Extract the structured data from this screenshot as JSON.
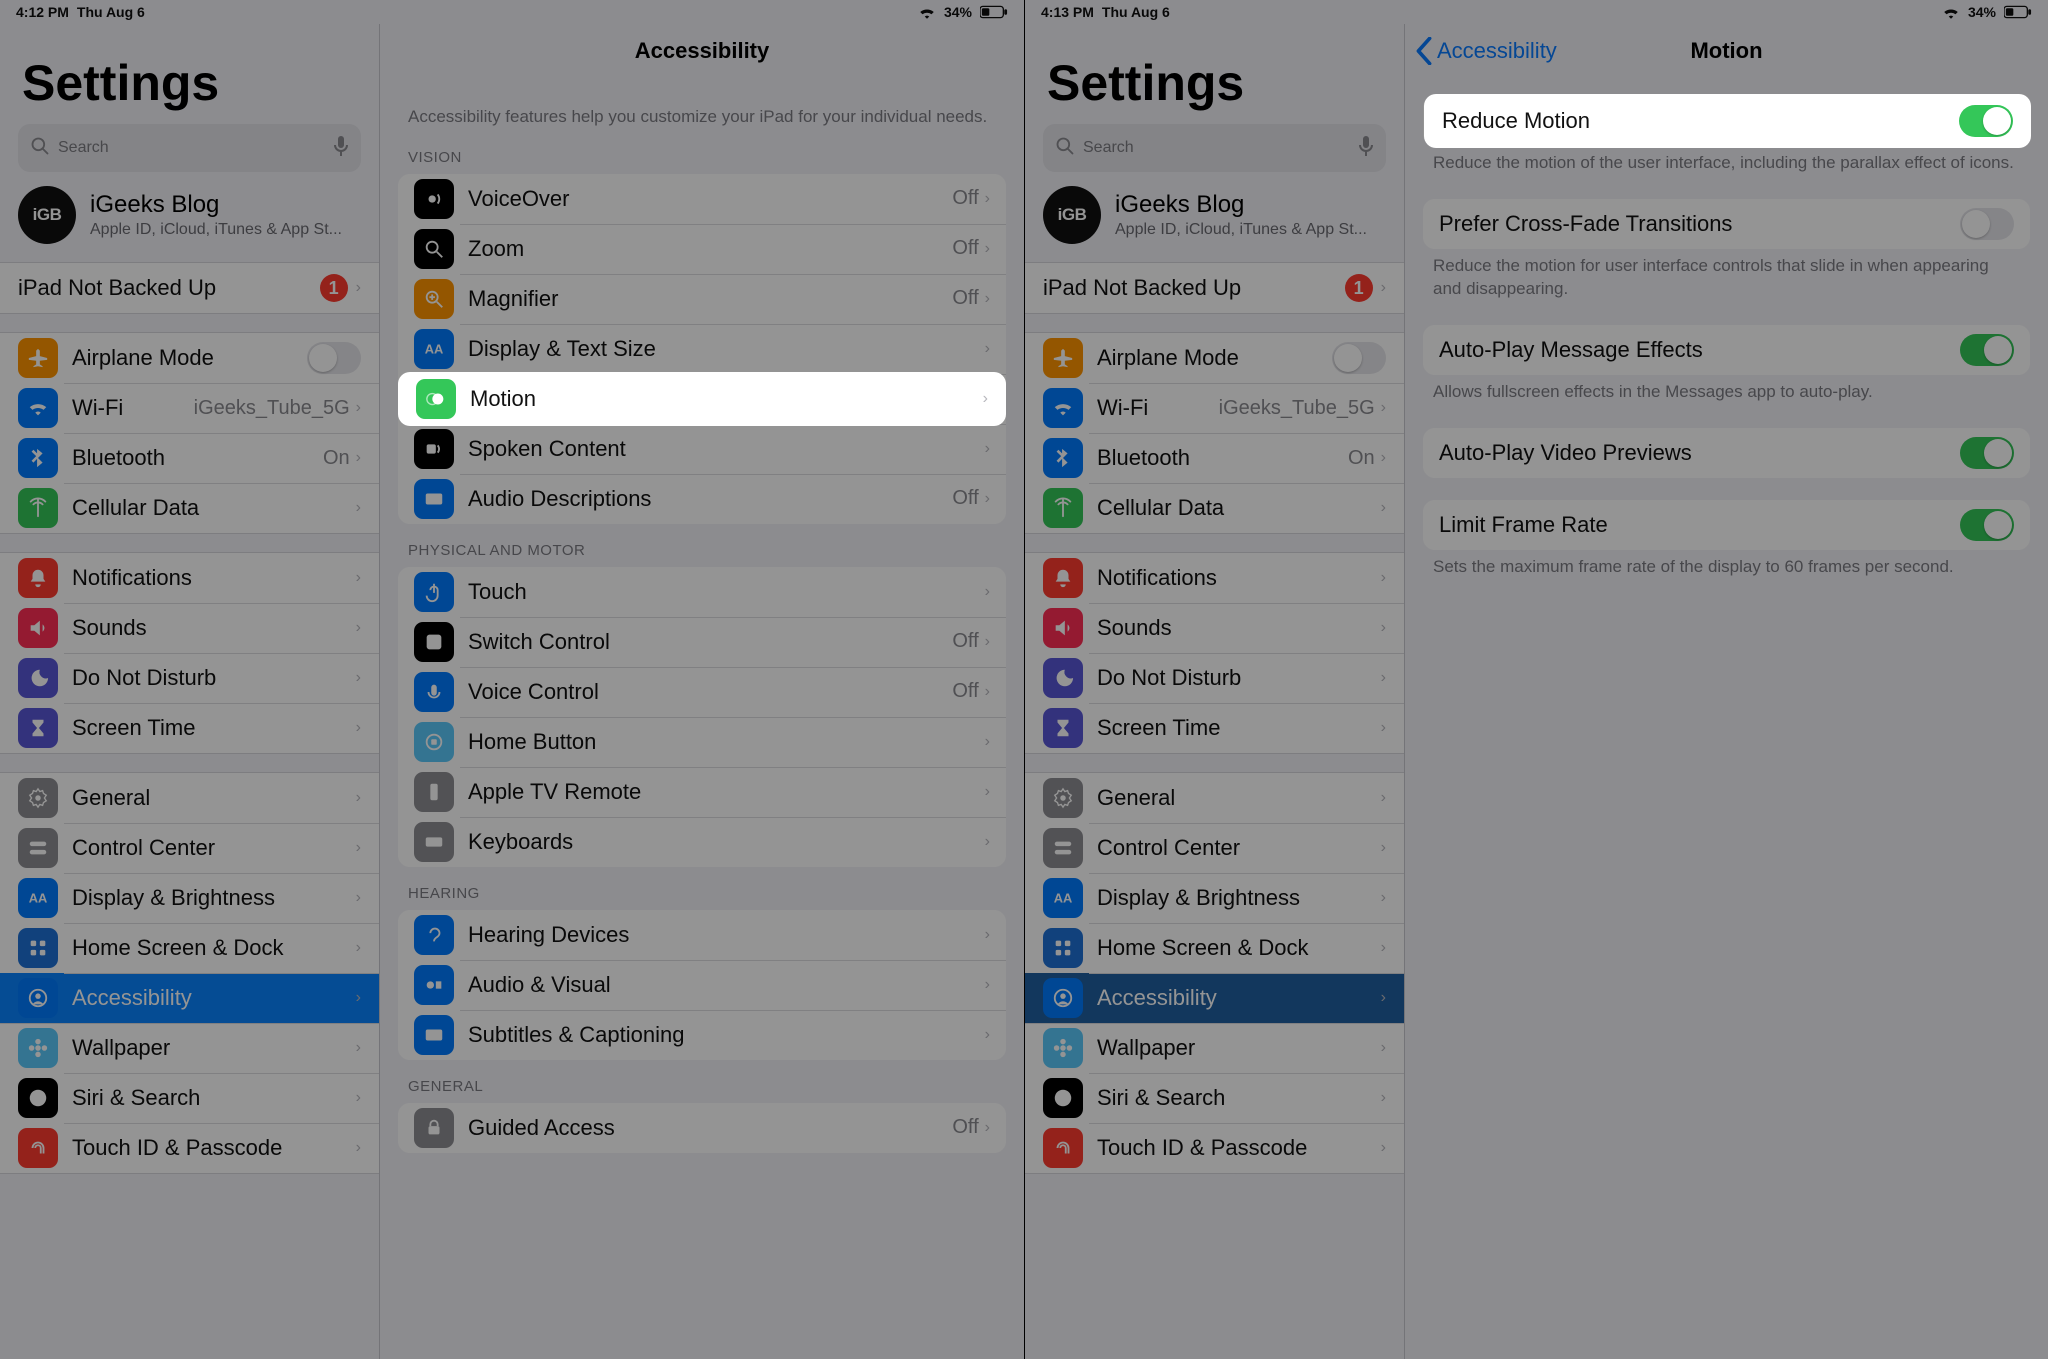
{
  "left": {
    "status": {
      "time": "4:12 PM",
      "date": "Thu Aug 6",
      "battery": "34%"
    },
    "side_title": "Settings",
    "search_placeholder": "Search",
    "profile": {
      "avatar": "iGB",
      "name": "iGeeks Blog",
      "sub": "Apple ID, iCloud, iTunes & App St..."
    },
    "backup_row": {
      "label": "iPad Not Backed Up",
      "badge": "1"
    },
    "rows_net": [
      {
        "label": "Airplane Mode",
        "icon": "airplane",
        "color": "c-orange",
        "type": "toggle",
        "on": false
      },
      {
        "label": "Wi-Fi",
        "icon": "wifi",
        "color": "c-blue",
        "aux": "iGeeks_Tube_5G"
      },
      {
        "label": "Bluetooth",
        "icon": "bluetooth",
        "color": "c-blue",
        "aux": "On"
      },
      {
        "label": "Cellular Data",
        "icon": "antenna",
        "color": "c-green"
      }
    ],
    "rows_notif": [
      {
        "label": "Notifications",
        "icon": "bell",
        "color": "c-red"
      },
      {
        "label": "Sounds",
        "icon": "speaker",
        "color": "c-pink"
      },
      {
        "label": "Do Not Disturb",
        "icon": "moon",
        "color": "c-purple"
      },
      {
        "label": "Screen Time",
        "icon": "hourglass",
        "color": "c-purple"
      }
    ],
    "rows_general": [
      {
        "label": "General",
        "icon": "gear",
        "color": "c-gray"
      },
      {
        "label": "Control Center",
        "icon": "switches",
        "color": "c-gray"
      },
      {
        "label": "Display & Brightness",
        "icon": "aa",
        "color": "c-blue"
      },
      {
        "label": "Home Screen & Dock",
        "icon": "grid",
        "color": "c-darkblue"
      },
      {
        "label": "Accessibility",
        "icon": "person",
        "color": "c-blue",
        "selected": true
      },
      {
        "label": "Wallpaper",
        "icon": "flower",
        "color": "c-teal"
      },
      {
        "label": "Siri & Search",
        "icon": "siri",
        "color": "c-black"
      },
      {
        "label": "Touch ID & Passcode",
        "icon": "fingerprint",
        "color": "c-red"
      }
    ],
    "detail": {
      "title": "Accessibility",
      "intro": "Accessibility features help you customize your iPad for your individual needs.",
      "sections": [
        {
          "header": "Vision",
          "rows": [
            {
              "label": "VoiceOver",
              "icon": "voiceover",
              "color": "c-black",
              "aux": "Off"
            },
            {
              "label": "Zoom",
              "icon": "zoom",
              "color": "c-black",
              "aux": "Off"
            },
            {
              "label": "Magnifier",
              "icon": "magnifier",
              "color": "c-orange",
              "aux": "Off"
            },
            {
              "label": "Display & Text Size",
              "icon": "aa",
              "color": "c-blue"
            },
            {
              "label": "Motion",
              "icon": "motion",
              "color": "c-green",
              "highlight": true
            },
            {
              "label": "Spoken Content",
              "icon": "spoken",
              "color": "c-black"
            },
            {
              "label": "Audio Descriptions",
              "icon": "ad",
              "color": "c-blue",
              "aux": "Off"
            }
          ]
        },
        {
          "header": "Physical and Motor",
          "rows": [
            {
              "label": "Touch",
              "icon": "touch",
              "color": "c-blue"
            },
            {
              "label": "Switch Control",
              "icon": "switch",
              "color": "c-black",
              "aux": "Off"
            },
            {
              "label": "Voice Control",
              "icon": "voice",
              "color": "c-blue",
              "aux": "Off"
            },
            {
              "label": "Home Button",
              "icon": "home",
              "color": "c-teal"
            },
            {
              "label": "Apple TV Remote",
              "icon": "remote",
              "color": "c-gray"
            },
            {
              "label": "Keyboards",
              "icon": "keyboard",
              "color": "c-gray"
            }
          ]
        },
        {
          "header": "Hearing",
          "rows": [
            {
              "label": "Hearing Devices",
              "icon": "ear",
              "color": "c-blue"
            },
            {
              "label": "Audio & Visual",
              "icon": "av",
              "color": "c-blue"
            },
            {
              "label": "Subtitles & Captioning",
              "icon": "cc",
              "color": "c-blue"
            }
          ]
        },
        {
          "header": "General",
          "rows": [
            {
              "label": "Guided Access",
              "icon": "lock",
              "color": "c-gray",
              "aux": "Off"
            }
          ]
        }
      ]
    }
  },
  "right": {
    "status": {
      "time": "4:13 PM",
      "date": "Thu Aug 6",
      "battery": "34%"
    },
    "side_title": "Settings",
    "search_placeholder": "Search",
    "profile": {
      "avatar": "iGB",
      "name": "iGeeks Blog",
      "sub": "Apple ID, iCloud, iTunes & App St..."
    },
    "backup_row": {
      "label": "iPad Not Backed Up",
      "badge": "1"
    },
    "detail": {
      "back": "Accessibility",
      "title": "Motion",
      "rows": [
        {
          "label": "Reduce Motion",
          "on": true,
          "highlight": true,
          "note": "Reduce the motion of the user interface, including the parallax effect of icons."
        },
        {
          "label": "Prefer Cross-Fade Transitions",
          "on": false,
          "note": "Reduce the motion for user interface controls that slide in when appearing and disappearing."
        },
        {
          "label": "Auto-Play Message Effects",
          "on": true,
          "note": "Allows fullscreen effects in the Messages app to auto-play."
        },
        {
          "label": "Auto-Play Video Previews",
          "on": true,
          "note": ""
        },
        {
          "label": "Limit Frame Rate",
          "on": true,
          "note": "Sets the maximum frame rate of the display to 60 frames per second."
        }
      ]
    }
  }
}
